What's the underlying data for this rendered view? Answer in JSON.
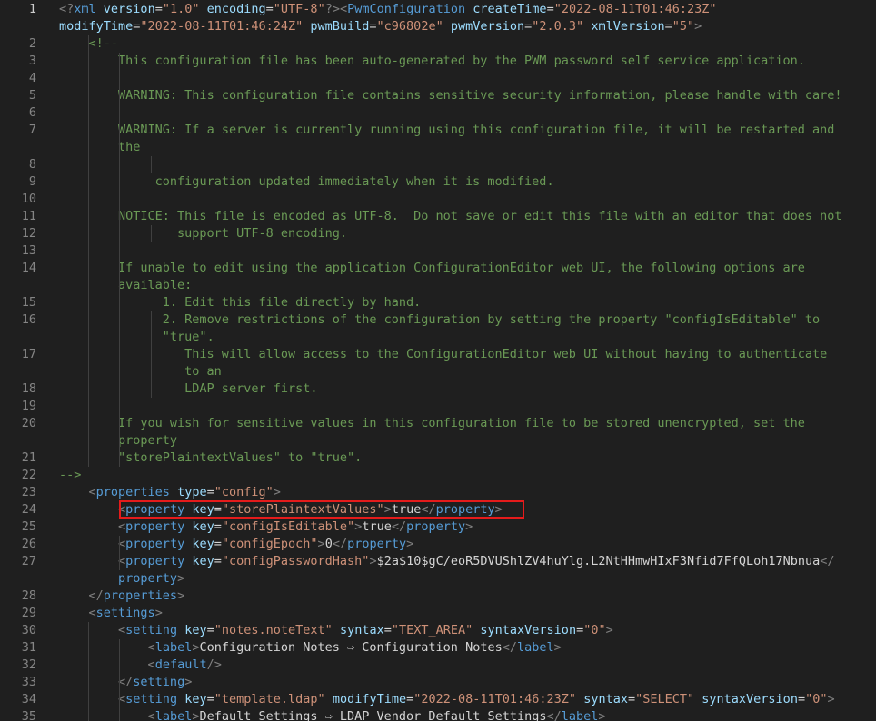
{
  "editor": {
    "language": "xml",
    "active_line": "1",
    "highlighted_line": "24",
    "colors": {
      "background": "#1f1f1f",
      "line_number": "#858585",
      "tag": "#569cd6",
      "attribute": "#9cdcfe",
      "string": "#ce9178",
      "comment": "#6a9955",
      "text": "#d4d4d4",
      "highlight_box": "#e51b1b"
    },
    "rows": [
      {
        "n": "1",
        "t": [
          [
            "gray",
            "<?"
          ],
          [
            "blue",
            "xml"
          ],
          [
            "text",
            " "
          ],
          [
            "attr",
            "version"
          ],
          [
            "text",
            "="
          ],
          [
            "str",
            "\"1.0\""
          ],
          [
            "text",
            " "
          ],
          [
            "attr",
            "encoding"
          ],
          [
            "text",
            "="
          ],
          [
            "str",
            "\"UTF-8\""
          ],
          [
            "gray",
            "?><"
          ],
          [
            "blue",
            "PwmConfiguration"
          ],
          [
            "text",
            " "
          ],
          [
            "attr",
            "createTime"
          ],
          [
            "text",
            "="
          ],
          [
            "str",
            "\"2022-08-11T01:46:23Z\""
          ]
        ]
      },
      {
        "n": "",
        "t": [
          [
            "attr",
            "modifyTime"
          ],
          [
            "text",
            "="
          ],
          [
            "str",
            "\"2022-08-11T01:46:24Z\""
          ],
          [
            "text",
            " "
          ],
          [
            "attr",
            "pwmBuild"
          ],
          [
            "text",
            "="
          ],
          [
            "str",
            "\"c96802e\""
          ],
          [
            "text",
            " "
          ],
          [
            "attr",
            "pwmVersion"
          ],
          [
            "text",
            "="
          ],
          [
            "str",
            "\"2.0.3\""
          ],
          [
            "text",
            " "
          ],
          [
            "attr",
            "xmlVersion"
          ],
          [
            "text",
            "="
          ],
          [
            "str",
            "\"5\""
          ],
          [
            "gray",
            ">"
          ]
        ]
      },
      {
        "n": "2",
        "t": [
          [
            "text",
            "    "
          ],
          [
            "com",
            "<!--"
          ]
        ]
      },
      {
        "n": "3",
        "t": [
          [
            "text",
            "        "
          ],
          [
            "com",
            "This configuration file has been auto-generated by the PWM password self service application."
          ]
        ]
      },
      {
        "n": "4",
        "t": []
      },
      {
        "n": "5",
        "t": [
          [
            "text",
            "        "
          ],
          [
            "com",
            "WARNING: This configuration file contains sensitive security information, please handle with care!"
          ]
        ]
      },
      {
        "n": "6",
        "t": []
      },
      {
        "n": "7",
        "t": [
          [
            "text",
            "        "
          ],
          [
            "com",
            "WARNING: If a server is currently running using this configuration file, it will be restarted and"
          ]
        ]
      },
      {
        "n": "",
        "t": [
          [
            "text",
            "        "
          ],
          [
            "com",
            "the"
          ]
        ]
      },
      {
        "n": "8",
        "t": []
      },
      {
        "n": "9",
        "t": [
          [
            "text",
            "             "
          ],
          [
            "com",
            "configuration updated immediately when it is modified."
          ]
        ]
      },
      {
        "n": "10",
        "t": []
      },
      {
        "n": "11",
        "t": [
          [
            "text",
            "        "
          ],
          [
            "com",
            "NOTICE: This file is encoded as UTF-8.  Do not save or edit this file with an editor that does not"
          ]
        ]
      },
      {
        "n": "12",
        "t": [
          [
            "text",
            "                "
          ],
          [
            "com",
            "support UTF-8 encoding."
          ]
        ]
      },
      {
        "n": "13",
        "t": []
      },
      {
        "n": "14",
        "t": [
          [
            "text",
            "        "
          ],
          [
            "com",
            "If unable to edit using the application ConfigurationEditor web UI, the following options are"
          ]
        ]
      },
      {
        "n": "",
        "t": [
          [
            "text",
            "        "
          ],
          [
            "com",
            "available:"
          ]
        ]
      },
      {
        "n": "15",
        "t": [
          [
            "text",
            "              "
          ],
          [
            "com",
            "1. Edit this file directly by hand."
          ]
        ]
      },
      {
        "n": "16",
        "t": [
          [
            "text",
            "              "
          ],
          [
            "com",
            "2. Remove restrictions of the configuration by setting the property \"configIsEditable\" to"
          ]
        ]
      },
      {
        "n": "",
        "t": [
          [
            "text",
            "              "
          ],
          [
            "com",
            "\"true\"."
          ]
        ]
      },
      {
        "n": "17",
        "t": [
          [
            "text",
            "                 "
          ],
          [
            "com",
            "This will allow access to the ConfigurationEditor web UI without having to authenticate"
          ]
        ]
      },
      {
        "n": "",
        "t": [
          [
            "text",
            "                 "
          ],
          [
            "com",
            "to an"
          ]
        ]
      },
      {
        "n": "18",
        "t": [
          [
            "text",
            "                 "
          ],
          [
            "com",
            "LDAP server first."
          ]
        ]
      },
      {
        "n": "19",
        "t": []
      },
      {
        "n": "20",
        "t": [
          [
            "text",
            "        "
          ],
          [
            "com",
            "If you wish for sensitive values in this configuration file to be stored unencrypted, set the"
          ]
        ]
      },
      {
        "n": "",
        "t": [
          [
            "text",
            "        "
          ],
          [
            "com",
            "property"
          ]
        ]
      },
      {
        "n": "21",
        "t": [
          [
            "text",
            "        "
          ],
          [
            "com",
            "\"storePlaintextValues\" to \"true\"."
          ]
        ]
      },
      {
        "n": "22",
        "t": [
          [
            "com",
            "-->"
          ]
        ]
      },
      {
        "n": "23",
        "t": [
          [
            "text",
            "    "
          ],
          [
            "gray",
            "<"
          ],
          [
            "blue",
            "properties"
          ],
          [
            "text",
            " "
          ],
          [
            "attr",
            "type"
          ],
          [
            "text",
            "="
          ],
          [
            "str",
            "\"config\""
          ],
          [
            "gray",
            ">"
          ]
        ]
      },
      {
        "n": "24",
        "t": [
          [
            "text",
            "        "
          ],
          [
            "gray",
            "<"
          ],
          [
            "blue",
            "property"
          ],
          [
            "text",
            " "
          ],
          [
            "attr",
            "key"
          ],
          [
            "text",
            "="
          ],
          [
            "str",
            "\"storePlaintextValues\""
          ],
          [
            "gray",
            ">"
          ],
          [
            "text",
            "true"
          ],
          [
            "gray",
            "</"
          ],
          [
            "blue",
            "property"
          ],
          [
            "gray",
            ">"
          ]
        ]
      },
      {
        "n": "25",
        "t": [
          [
            "text",
            "        "
          ],
          [
            "gray",
            "<"
          ],
          [
            "blue",
            "property"
          ],
          [
            "text",
            " "
          ],
          [
            "attr",
            "key"
          ],
          [
            "text",
            "="
          ],
          [
            "str",
            "\"configIsEditable\""
          ],
          [
            "gray",
            ">"
          ],
          [
            "text",
            "true"
          ],
          [
            "gray",
            "</"
          ],
          [
            "blue",
            "property"
          ],
          [
            "gray",
            ">"
          ]
        ]
      },
      {
        "n": "26",
        "t": [
          [
            "text",
            "        "
          ],
          [
            "gray",
            "<"
          ],
          [
            "blue",
            "property"
          ],
          [
            "text",
            " "
          ],
          [
            "attr",
            "key"
          ],
          [
            "text",
            "="
          ],
          [
            "str",
            "\"configEpoch\""
          ],
          [
            "gray",
            ">"
          ],
          [
            "text",
            "0"
          ],
          [
            "gray",
            "</"
          ],
          [
            "blue",
            "property"
          ],
          [
            "gray",
            ">"
          ]
        ]
      },
      {
        "n": "27",
        "t": [
          [
            "text",
            "        "
          ],
          [
            "gray",
            "<"
          ],
          [
            "blue",
            "property"
          ],
          [
            "text",
            " "
          ],
          [
            "attr",
            "key"
          ],
          [
            "text",
            "="
          ],
          [
            "str",
            "\"configPasswordHash\""
          ],
          [
            "gray",
            ">"
          ],
          [
            "text",
            "$2a$10$gC/eoR5DVUShlZV4huYlg.L2NtHHmwHIxF3Nfid7FfQLoh17Nbnua"
          ],
          [
            "gray",
            "</"
          ]
        ]
      },
      {
        "n": "",
        "t": [
          [
            "text",
            "        "
          ],
          [
            "blue",
            "property"
          ],
          [
            "gray",
            ">"
          ]
        ]
      },
      {
        "n": "28",
        "t": [
          [
            "text",
            "    "
          ],
          [
            "gray",
            "</"
          ],
          [
            "blue",
            "properties"
          ],
          [
            "gray",
            ">"
          ]
        ]
      },
      {
        "n": "29",
        "t": [
          [
            "text",
            "    "
          ],
          [
            "gray",
            "<"
          ],
          [
            "blue",
            "settings"
          ],
          [
            "gray",
            ">"
          ]
        ]
      },
      {
        "n": "30",
        "t": [
          [
            "text",
            "        "
          ],
          [
            "gray",
            "<"
          ],
          [
            "blue",
            "setting"
          ],
          [
            "text",
            " "
          ],
          [
            "attr",
            "key"
          ],
          [
            "text",
            "="
          ],
          [
            "str",
            "\"notes.noteText\""
          ],
          [
            "text",
            " "
          ],
          [
            "attr",
            "syntax"
          ],
          [
            "text",
            "="
          ],
          [
            "str",
            "\"TEXT_AREA\""
          ],
          [
            "text",
            " "
          ],
          [
            "attr",
            "syntaxVersion"
          ],
          [
            "text",
            "="
          ],
          [
            "str",
            "\"0\""
          ],
          [
            "gray",
            ">"
          ]
        ]
      },
      {
        "n": "31",
        "t": [
          [
            "text",
            "            "
          ],
          [
            "gray",
            "<"
          ],
          [
            "blue",
            "label"
          ],
          [
            "gray",
            ">"
          ],
          [
            "text",
            "Configuration Notes ⇨ Configuration Notes"
          ],
          [
            "gray",
            "</"
          ],
          [
            "blue",
            "label"
          ],
          [
            "gray",
            ">"
          ]
        ]
      },
      {
        "n": "32",
        "t": [
          [
            "text",
            "            "
          ],
          [
            "gray",
            "<"
          ],
          [
            "blue",
            "default"
          ],
          [
            "gray",
            "/>"
          ]
        ]
      },
      {
        "n": "33",
        "t": [
          [
            "text",
            "        "
          ],
          [
            "gray",
            "</"
          ],
          [
            "blue",
            "setting"
          ],
          [
            "gray",
            ">"
          ]
        ]
      },
      {
        "n": "34",
        "t": [
          [
            "text",
            "        "
          ],
          [
            "gray",
            "<"
          ],
          [
            "blue",
            "setting"
          ],
          [
            "text",
            " "
          ],
          [
            "attr",
            "key"
          ],
          [
            "text",
            "="
          ],
          [
            "str",
            "\"template.ldap\""
          ],
          [
            "text",
            " "
          ],
          [
            "attr",
            "modifyTime"
          ],
          [
            "text",
            "="
          ],
          [
            "str",
            "\"2022-08-11T01:46:23Z\""
          ],
          [
            "text",
            " "
          ],
          [
            "attr",
            "syntax"
          ],
          [
            "text",
            "="
          ],
          [
            "str",
            "\"SELECT\""
          ],
          [
            "text",
            " "
          ],
          [
            "attr",
            "syntaxVersion"
          ],
          [
            "text",
            "="
          ],
          [
            "str",
            "\"0\""
          ],
          [
            "gray",
            ">"
          ]
        ]
      },
      {
        "n": "35",
        "t": [
          [
            "text",
            "            "
          ],
          [
            "gray",
            "<"
          ],
          [
            "blue",
            "label"
          ],
          [
            "gray",
            ">"
          ],
          [
            "text",
            "Default Settings ⇨ LDAP Vendor Default Settings"
          ],
          [
            "gray",
            "</"
          ],
          [
            "blue",
            "label"
          ],
          [
            "gray",
            ">"
          ]
        ]
      }
    ]
  }
}
